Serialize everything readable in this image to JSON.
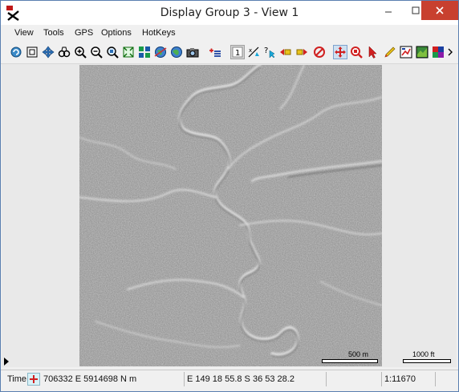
{
  "window": {
    "title": "Display Group 3 - View 1"
  },
  "menu": {
    "items": [
      "View",
      "Tools",
      "GPS",
      "Options",
      "HotKeys"
    ]
  },
  "toolbar": {
    "icons": [
      "redraw-icon",
      "full-extent-icon",
      "pan-to-center-icon",
      "zoom-binoculars-icon",
      "zoom-in-icon",
      "zoom-out-icon",
      "zoom-to-layer-icon",
      "zoom-box-icon",
      "zoom-layer-icon",
      "globe-icon",
      "locator-globe-icon",
      "snapshot-camera-icon",
      "add-layer-icon",
      "select-layer-icon",
      "measure-icon",
      "help-pointer-icon",
      "previous-view-icon",
      "next-view-icon",
      "cancel-icon",
      "pan-tool-icon",
      "zoom-tool-icon",
      "pointer-tool-icon",
      "sketch-pencil-icon",
      "legend-icon",
      "layer-list-icon",
      "color-icon",
      "more-icon"
    ]
  },
  "map": {
    "scale_label_metric": "500 m",
    "scale_label_imperial": "1000 ft"
  },
  "status": {
    "time_label": "Time",
    "coords_map": "706332 E  5914698 N m",
    "coords_geo": "E 149 18 55.8  S 36 53 28.2",
    "scale": "1:11670"
  }
}
